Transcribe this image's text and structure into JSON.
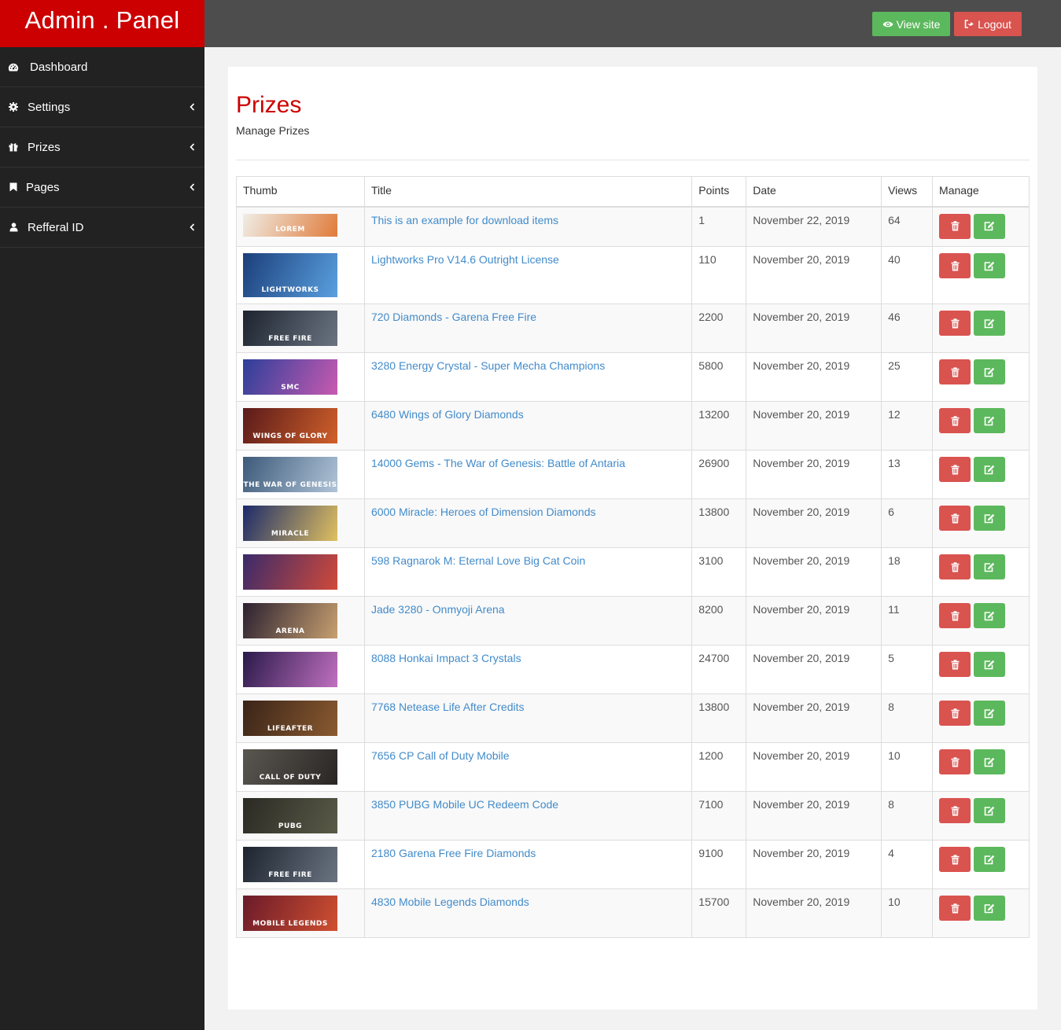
{
  "brand": "Admin . Panel",
  "sidebar": {
    "items": [
      {
        "label": "Dashboard",
        "icon": "dashboard-icon"
      },
      {
        "label": "Settings",
        "icon": "gear-icon"
      },
      {
        "label": "Prizes",
        "icon": "gift-icon"
      },
      {
        "label": "Pages",
        "icon": "bookmark-icon"
      },
      {
        "label": "Refferal ID",
        "icon": "user-icon"
      }
    ]
  },
  "topbar": {
    "view_site": "View site",
    "logout": "Logout"
  },
  "page": {
    "title": "Prizes",
    "subtitle": "Manage Prizes"
  },
  "table": {
    "headers": [
      "Thumb",
      "Title",
      "Points",
      "Date",
      "Views",
      "Manage"
    ],
    "rows": [
      {
        "title": "This is an example for download items",
        "points": "1",
        "date": "November 22, 2019",
        "views": "64"
      },
      {
        "title": "Lightworks Pro V14.6 Outright License",
        "points": "110",
        "date": "November 20, 2019",
        "views": "40"
      },
      {
        "title": "720 Diamonds - Garena Free Fire",
        "points": "2200",
        "date": "November 20, 2019",
        "views": "46"
      },
      {
        "title": "3280 Energy Crystal - Super Mecha Champions",
        "points": "5800",
        "date": "November 20, 2019",
        "views": "25"
      },
      {
        "title": "6480 Wings of Glory Diamonds",
        "points": "13200",
        "date": "November 20, 2019",
        "views": "12"
      },
      {
        "title": "14000 Gems - The War of Genesis: Battle of Antaria",
        "points": "26900",
        "date": "November 20, 2019",
        "views": "13"
      },
      {
        "title": "6000 Miracle: Heroes of Dimension Diamonds",
        "points": "13800",
        "date": "November 20, 2019",
        "views": "6"
      },
      {
        "title": "598 Ragnarok M: Eternal Love Big Cat Coin",
        "points": "3100",
        "date": "November 20, 2019",
        "views": "18"
      },
      {
        "title": "Jade 3280 - Onmyoji Arena",
        "points": "8200",
        "date": "November 20, 2019",
        "views": "11"
      },
      {
        "title": "8088 Honkai Impact 3 Crystals",
        "points": "24700",
        "date": "November 20, 2019",
        "views": "5"
      },
      {
        "title": "7768 Netease Life After Credits",
        "points": "13800",
        "date": "November 20, 2019",
        "views": "8"
      },
      {
        "title": "7656 CP Call of Duty Mobile",
        "points": "1200",
        "date": "November 20, 2019",
        "views": "10"
      },
      {
        "title": "3850 PUBG Mobile UC Redeem Code",
        "points": "7100",
        "date": "November 20, 2019",
        "views": "8"
      },
      {
        "title": "2180 Garena Free Fire Diamonds",
        "points": "9100",
        "date": "November 20, 2019",
        "views": "4"
      },
      {
        "title": "4830 Mobile Legends Diamonds",
        "points": "15700",
        "date": "November 20, 2019",
        "views": "10"
      }
    ]
  },
  "thumbs": [
    {
      "c1": "#f0ede6",
      "c2": "#e07b3a",
      "label": "LOREM"
    },
    {
      "c1": "#1b3f7a",
      "c2": "#5aa0e0",
      "label": "LIGHTWORKS"
    },
    {
      "c1": "#1d2430",
      "c2": "#6a7480",
      "label": "FREE FIRE"
    },
    {
      "c1": "#2c3f9a",
      "c2": "#c85ab0",
      "label": "SMC"
    },
    {
      "c1": "#5a1a1a",
      "c2": "#d0602a",
      "label": "WINGS OF GLORY"
    },
    {
      "c1": "#3d5a7a",
      "c2": "#b0c4d8",
      "label": "THE WAR OF GENESIS"
    },
    {
      "c1": "#1c2a6a",
      "c2": "#e0c060",
      "label": "MIRACLE"
    },
    {
      "c1": "#3a2a6a",
      "c2": "#d04a3a",
      "label": ""
    },
    {
      "c1": "#2a2030",
      "c2": "#c8a070",
      "label": "ARENA"
    },
    {
      "c1": "#2a1a4a",
      "c2": "#c070c0",
      "label": ""
    },
    {
      "c1": "#3a2418",
      "c2": "#8a5a30",
      "label": "LIFEAFTER"
    },
    {
      "c1": "#5a5650",
      "c2": "#2a2624",
      "label": "CALL OF DUTY"
    },
    {
      "c1": "#2a2a24",
      "c2": "#5a5a48",
      "label": "PUBG"
    },
    {
      "c1": "#1d2430",
      "c2": "#6a7480",
      "label": "FREE FIRE"
    },
    {
      "c1": "#6a1a2a",
      "c2": "#d05030",
      "label": "MOBILE LEGENDS"
    }
  ]
}
